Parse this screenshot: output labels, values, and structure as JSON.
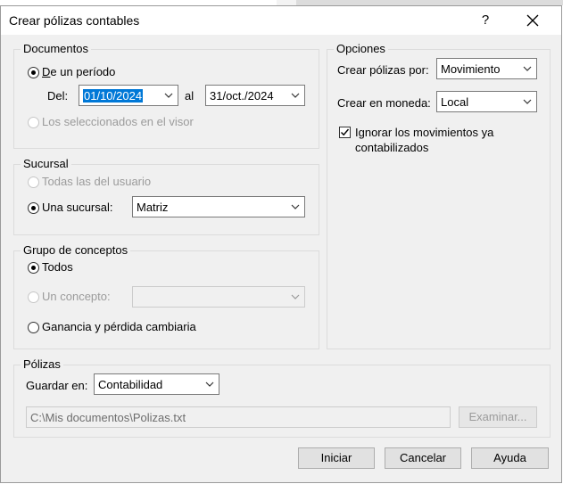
{
  "dialog": {
    "title": "Crear pólizas contables",
    "help_label": "?"
  },
  "documentos": {
    "group_label": "Documentos",
    "periodo_label": "De un período",
    "del_label": "Del:",
    "date_from": "01/10/2024",
    "al_label": "al",
    "date_to": "31/oct./2024",
    "seleccionados_label": "Los seleccionados en el visor"
  },
  "sucursal": {
    "group_label": "Sucursal",
    "todas_label": "Todas las del usuario",
    "una_label": "Una sucursal:",
    "una_value": "Matriz"
  },
  "grupo": {
    "group_label": "Grupo de conceptos",
    "todos_label": "Todos",
    "un_concepto_label": "Un concepto:",
    "un_concepto_value": "",
    "ganancia_label": "Ganancia y pérdida cambiaria"
  },
  "opciones": {
    "group_label": "Opciones",
    "crear_por_label": "Crear pólizas por:",
    "crear_por_value": "Movimiento",
    "moneda_label": "Crear en moneda:",
    "moneda_value": "Local",
    "ignorar_label_1": "Ignorar los movimientos ya",
    "ignorar_label_2": "contabilizados"
  },
  "polizas": {
    "group_label": "Pólizas",
    "guardar_label": "Guardar en:",
    "guardar_value": "Contabilidad",
    "path_value": "C:\\Mis documentos\\Polizas.txt",
    "examinar_label": "Examinar..."
  },
  "buttons": {
    "iniciar": "Iniciar",
    "cancelar": "Cancelar",
    "ayuda": "Ayuda"
  }
}
